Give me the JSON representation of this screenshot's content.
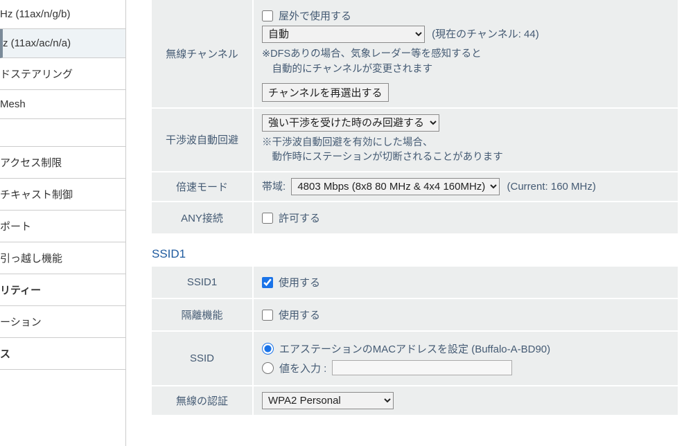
{
  "sidebar": {
    "items": [
      {
        "label": "Hz (11ax/n/g/b)"
      },
      {
        "label": "z (11ax/ac/n/a)",
        "selected": true
      },
      {
        "label": "ドステアリング"
      },
      {
        "label": "Mesh"
      },
      {
        "label": ""
      },
      {
        "label": "アクセス制限"
      },
      {
        "label": "チキャスト制御"
      },
      {
        "label": "ポート"
      },
      {
        "label": "引っ越し機能"
      },
      {
        "label": "リティー",
        "bold": true
      },
      {
        "label": "ーション"
      },
      {
        "label": "ス",
        "bold": true
      }
    ]
  },
  "channel": {
    "row_label": "無線チャンネル",
    "outdoor_label": "屋外で使用する",
    "select_value": "自動",
    "current_text": "(現在のチャンネル: 44)",
    "note_line1": "※DFSありの場合、気象レーダー等を感知すると",
    "note_line2": "自動的にチャンネルが変更されます",
    "reselect_button": "チャンネルを再選出する"
  },
  "interference": {
    "row_label": "干渉波自動回避",
    "select_value": "強い干渉を受けた時のみ回避する",
    "note_line1": "※干渉波自動回避を有効にした場合、",
    "note_line2": "動作時にステーションが切断されることがあります"
  },
  "speed_mode": {
    "row_label": "倍速モード",
    "field_label": "帯域:",
    "select_value": "4803 Mbps (8x8 80 MHz & 4x4 160MHz)",
    "current_text": "(Current: 160 MHz)"
  },
  "any_connect": {
    "row_label": "ANY接続",
    "label": "許可する"
  },
  "ssid_section_title": "SSID1",
  "ssid1": {
    "row_label": "SSID1",
    "checkbox_label": "使用する"
  },
  "isolation": {
    "row_label": "隔離機能",
    "checkbox_label": "使用する"
  },
  "ssid": {
    "row_label": "SSID",
    "radio1_label": "エアステーションのMACアドレスを設定 (Buffalo-A-BD90)",
    "radio2_label": "値を入力 :",
    "input_value": ""
  },
  "auth": {
    "row_label": "無線の認証",
    "select_value": "WPA2 Personal"
  }
}
